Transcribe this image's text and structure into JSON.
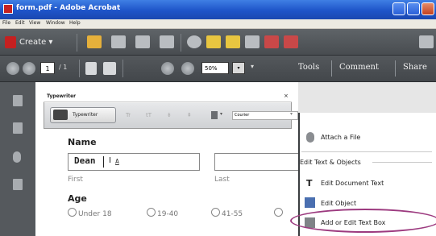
{
  "window": {
    "title": "form.pdf - Adobe Acrobat"
  },
  "menu": {
    "items": [
      "File",
      "Edit",
      "View",
      "Window",
      "Help"
    ]
  },
  "toolbar": {
    "create_label": "Create"
  },
  "nav": {
    "page_current": "1",
    "page_total": "/ 1",
    "zoom": "50%",
    "links": [
      "Tools",
      "Comment",
      "Share"
    ]
  },
  "typewriter": {
    "title": "Typewriter",
    "close": "×",
    "button_label": "Typewriter",
    "font": "Courier"
  },
  "form": {
    "name_label": "Name",
    "name_value": "Dean",
    "cursor_char": "I",
    "cursor_suffix": "A",
    "first_hint": "First",
    "last_hint": "Last",
    "age_label": "Age",
    "age_options": [
      "Under 18",
      "19-40",
      "41-55"
    ]
  },
  "tools_panel": {
    "attach_file": "Attach a File",
    "section_heading": "Edit Text & Objects",
    "items": [
      "Edit Document Text",
      "Edit Object",
      "Add or Edit Text Box"
    ]
  },
  "colors": {
    "highlight": "#9c3a7f",
    "titlebar": "#1e54c9"
  }
}
